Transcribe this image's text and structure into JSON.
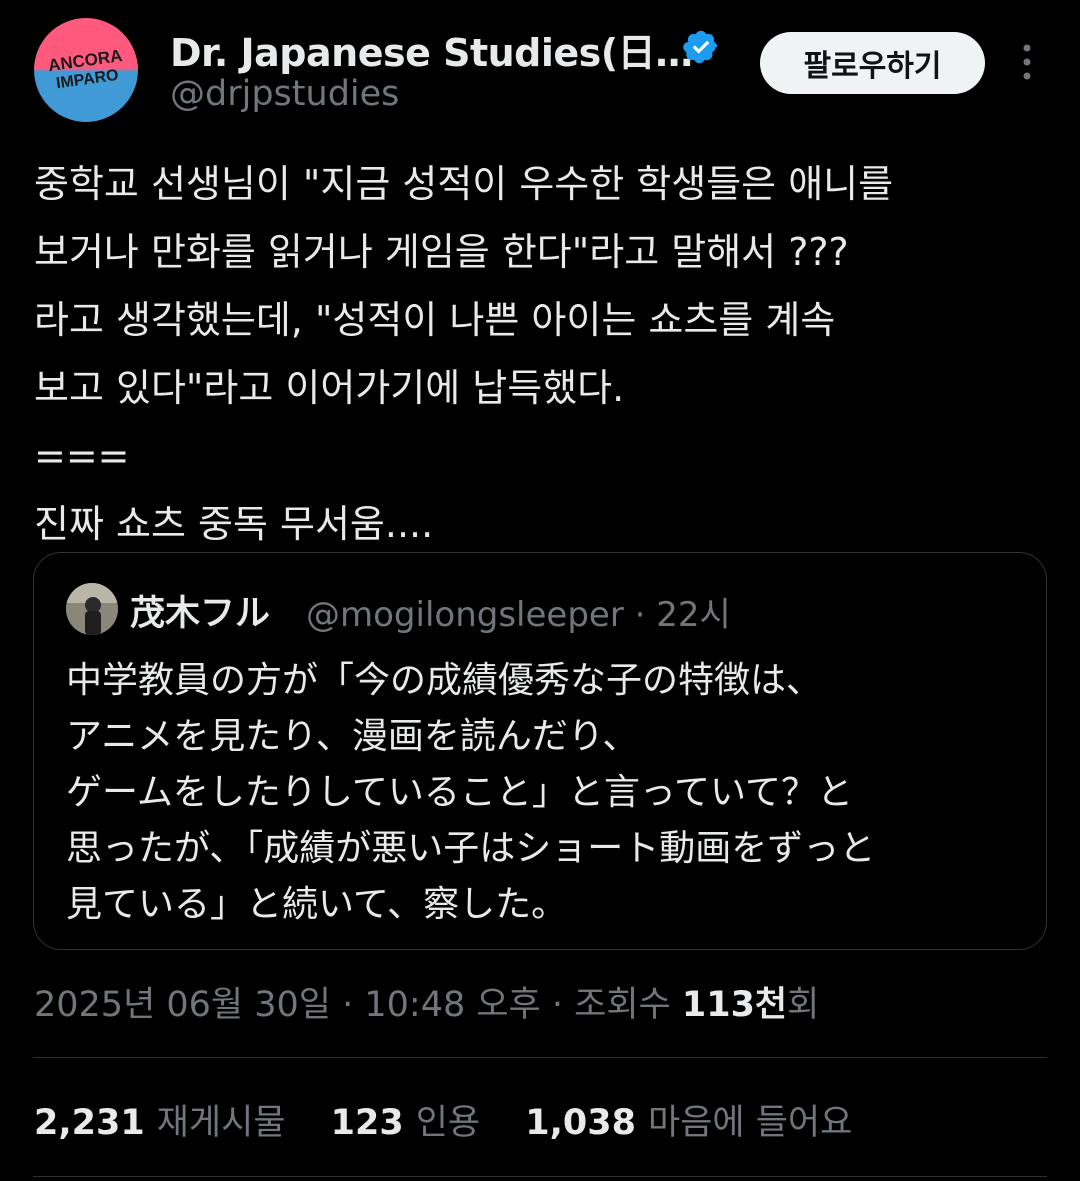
{
  "author": {
    "display_name": "Dr. Japanese Studies(日…",
    "handle": "@drjpstudies",
    "avatar_text_top": "ANCORA",
    "avatar_text_bottom": "IMPARO",
    "verified_icon": "verified-badge-icon",
    "verified_color": "#1d9bf0"
  },
  "actions": {
    "follow_label": "팔로우하기",
    "more_icon": "more-vertical-icon"
  },
  "tweet": {
    "lines": [
      "중학교 선생님이 \"지금 성적이 우수한 학생들은 애니를",
      "보거나 만화를 읽거나 게임을 한다\"라고 말해서 ???",
      "라고 생각했는데, \"성적이 나쁜 아이는 쇼츠를 계속",
      "보고 있다\"라고 이어가기에 납득했다.",
      "===",
      "진짜 쇼츠 중독 무서움...."
    ]
  },
  "quote": {
    "name": "茂木フル",
    "handle_time": "@mogilongsleeper · 22시",
    "lines": [
      "中学教員の方が「今の成績優秀な子の特徴は、",
      "アニメを見たり、漫画を読んだり、",
      "ゲームをしたりしていること」と言っていて？と",
      "思ったが、「成績が悪い子はショート動画をずっと",
      "見ている」と続いて、察した。"
    ]
  },
  "meta": {
    "timestamp": "2025년 06월 30일 · 10:48 오후 · 조회수 ",
    "views_number": "113천",
    "views_suffix": "회"
  },
  "stats": {
    "reposts_count": "2,231",
    "reposts_label": "재게시물",
    "quotes_count": "123",
    "quotes_label": "인용",
    "likes_count": "1,038",
    "likes_label": "마음에 들어요"
  }
}
